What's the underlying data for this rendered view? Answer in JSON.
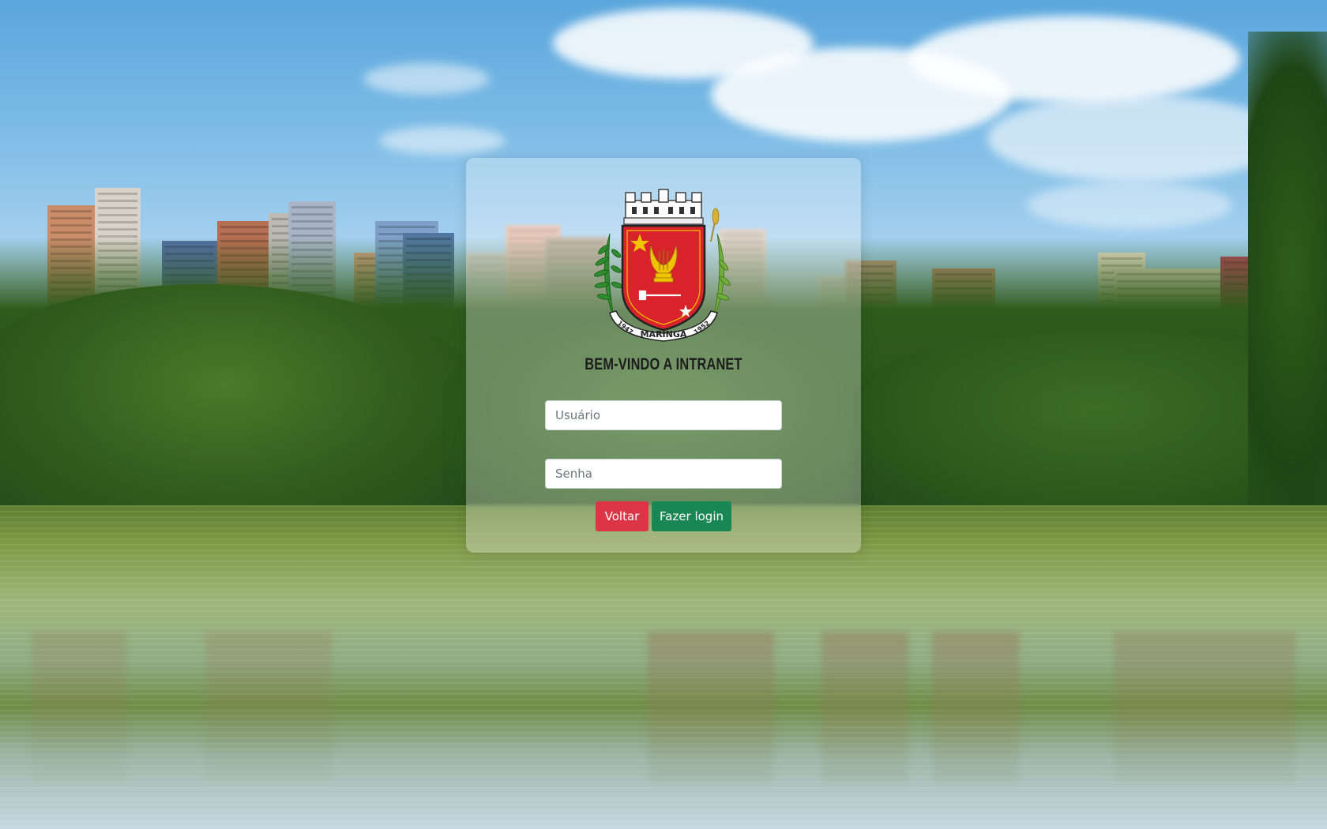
{
  "page": {
    "welcome_text": "BEM-VINDO A INTRANET",
    "logo": {
      "label": "MARINGÁ",
      "year_left": "1947",
      "year_right": "1952"
    },
    "form": {
      "username_placeholder": "Usuário",
      "password_placeholder": "Senha",
      "back_label": "Voltar",
      "login_label": "Fazer login"
    }
  },
  "colors": {
    "back_button": "#dc3545",
    "login_button": "#198754",
    "crest_red": "#d8232a",
    "crest_gold": "#f2c400"
  }
}
